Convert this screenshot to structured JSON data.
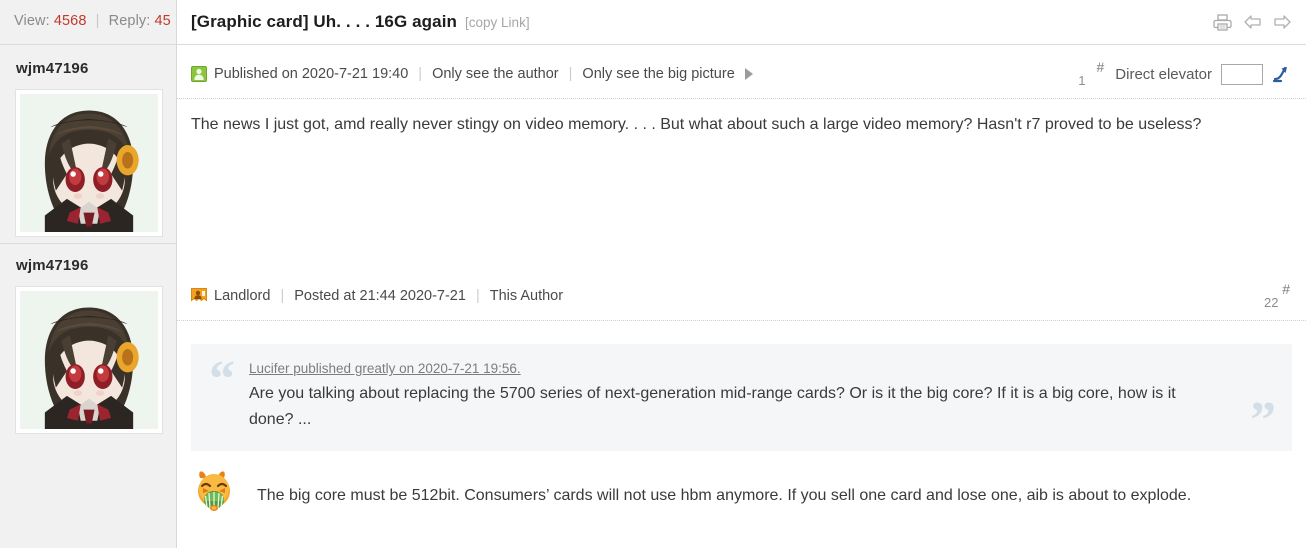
{
  "sidebar": {
    "stats": {
      "view_label": "View:",
      "view_count": "4568",
      "separator": "|",
      "reply_label": "Reply:",
      "reply_count": "45"
    },
    "users": [
      {
        "name": "wjm47196",
        "avatar_icon": "anime-girl-avatar"
      },
      {
        "name": "wjm47196",
        "avatar_icon": "anime-girl-avatar"
      }
    ]
  },
  "header": {
    "title": "[Graphic card] Uh. . . . 16G again",
    "copy_link": "[copy Link]",
    "actions": [
      {
        "icon": "print-icon",
        "name": "print-button"
      },
      {
        "icon": "arrow-left-icon",
        "name": "previous-thread-button"
      },
      {
        "icon": "arrow-right-icon",
        "name": "next-thread-button"
      }
    ]
  },
  "posts": [
    {
      "meta": {
        "author_icon": "green-user-icon",
        "published": "Published on 2020-7-21 19:40",
        "divider": "|",
        "only_author": "Only see the author",
        "only_big_picture": "Only see the big picture",
        "expand_icon": "triangle-right-icon"
      },
      "floor": {
        "hash": "#",
        "number": "1"
      },
      "elevator": {
        "label": "Direct elevator",
        "input_value": "",
        "input_placeholder": "",
        "go_icon": "jump-arrow-icon"
      },
      "body": "The news I just got, amd really never stingy on video memory. . . . But what about such a large video memory? Hasn't r7 proved to be useless?"
    },
    {
      "meta": {
        "author_icon": "orange-landlord-icon",
        "landlord": "Landlord",
        "divider": "|",
        "posted": "Posted at 21:44 2020-7-21",
        "this_author": "This Author"
      },
      "floor": {
        "hash": "#",
        "number": "22"
      },
      "quote": {
        "open_mark": "“",
        "close_mark": "”",
        "author_line": "Lucifer published greatly on 2020-7-21 19:56.",
        "text": "Are you talking about replacing the 5700 series of next-generation mid-range cards? Or is it the big core? If it is a big core, how is it done? ..."
      },
      "body": {
        "emoji_icon": "orange-crying-fan-emoji",
        "text": "The big core must be 512bit. Consumers’   cards will not use hbm anymore. If you sell one card and lose one, aib is about to explode."
      }
    }
  ],
  "colors": {
    "sidebar_bg": "#f1f1f1",
    "accent_red": "#c23a2b",
    "quote_bg": "#f5f6f7",
    "quote_mark": "#d3dfe8",
    "elevator_blue": "#2a5d9e"
  }
}
